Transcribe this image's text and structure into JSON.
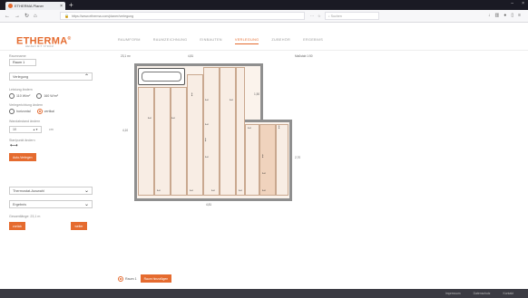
{
  "browser": {
    "tab_title": "ETHERMA Planer",
    "url": "https://www.etherma.com/planer/verlegung",
    "search_placeholder": "Suchen"
  },
  "header": {
    "logo": "ETHERMA",
    "logo_mark": "®",
    "logo_sub": "HEIZEN MIT STROM",
    "nav": [
      "RAUMFORM",
      "RAUMZEICHNUNG",
      "EINBAUTEN",
      "VERLEGUNG",
      "ZUBEHÖR",
      "ERGEBNIS"
    ],
    "active_nav": "VERLEGUNG"
  },
  "sidebar": {
    "room_label": "Raumname",
    "room_value": "Raum 1",
    "section_laying": "Verlegung",
    "power_label": "Leistung ändern",
    "power_options": [
      "110 W/m²",
      "160 W/m²"
    ],
    "direction_label": "Verlegerichtung ändern",
    "direction_options": [
      "horizontal",
      "vertikal"
    ],
    "distance_label": "Wandabstand ändern",
    "distance_value": "10",
    "distance_unit": "cm",
    "start_label": "Startpunkt ändern",
    "auto_button": "Auto-Verlegen",
    "section_thermostat": "Thermostat-Auswahl",
    "section_result": "Ergebnis",
    "total_label": "Gesamtlänge: 23,1 m",
    "back_button": "zurück",
    "next_button": "weiter"
  },
  "plan": {
    "area": "23,1 m²",
    "dim_top": "4,81",
    "dim_bottom": "4,81",
    "dim_left": "4,10",
    "dim_right": "2,70",
    "dim_inner": "1,50",
    "dim_right_top": "Maßstab 1:50"
  },
  "bottom": {
    "room_radio": "Raum 1",
    "add_button": "Raum hinzufügen"
  },
  "footer": {
    "links": [
      "Impressum",
      "Datenschutz",
      "Kontakt"
    ]
  },
  "colors": {
    "accent": "#e56b2f",
    "wall": "#8f8f8f",
    "mat": "#f8ede4"
  }
}
